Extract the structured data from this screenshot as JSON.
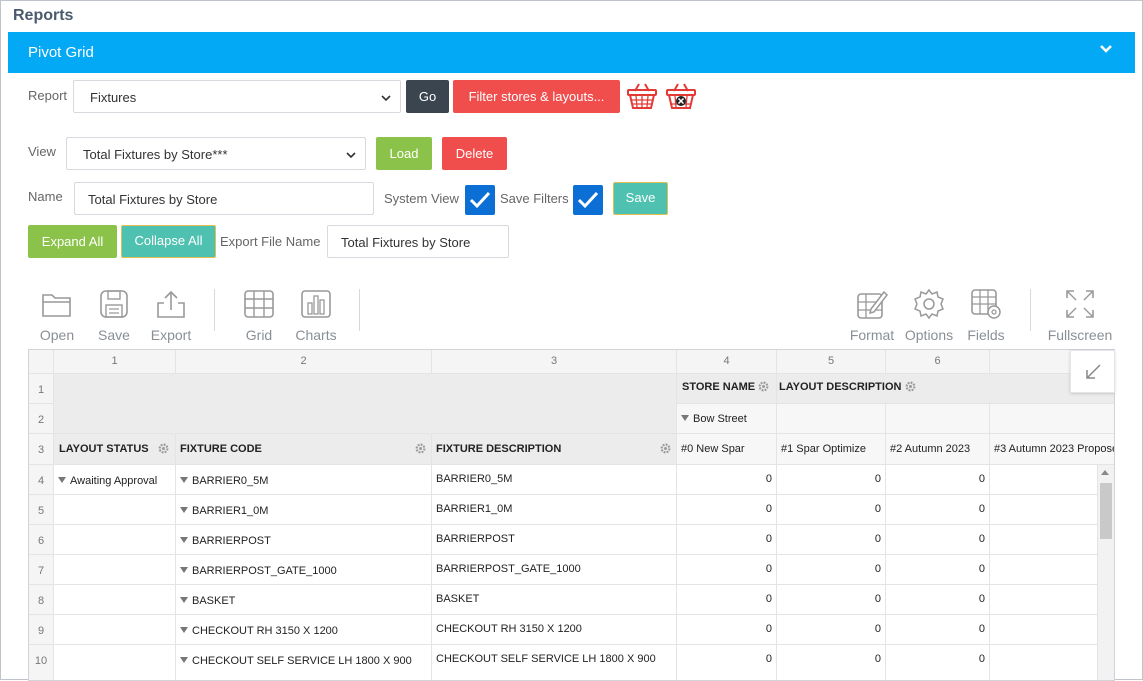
{
  "page": {
    "title": "Reports"
  },
  "panel": {
    "title": "Pivot Grid"
  },
  "report": {
    "label": "Report",
    "selected": "Fixtures",
    "go": "Go",
    "filter": "Filter stores & layouts..."
  },
  "view": {
    "label": "View",
    "selected": "Total Fixtures by Store***",
    "load": "Load",
    "delete": "Delete"
  },
  "name": {
    "label": "Name",
    "value": "Total Fixtures by Store",
    "system_view": "System View",
    "save_filters": "Save Filters",
    "save": "Save"
  },
  "expand": {
    "expand_all": "Expand All",
    "collapse_all": "Collapse All",
    "export_label": "Export File Name",
    "export_value": "Total Fixtures by Store"
  },
  "toolbar": {
    "open": "Open",
    "save": "Save",
    "export": "Export",
    "grid": "Grid",
    "charts": "Charts",
    "format": "Format",
    "options": "Options",
    "fields": "Fields",
    "fullscreen": "Fullscreen"
  },
  "colors": {
    "header": "#03a9f4",
    "dark": "#3b4550",
    "red": "#f04d4d",
    "green": "#8bc34a",
    "teal": "#4fc1b1",
    "check": "#0b6fd6"
  },
  "grid": {
    "col_numbers": [
      "1",
      "2",
      "3",
      "4",
      "5",
      "6"
    ],
    "row_numbers": [
      "1",
      "2",
      "3",
      "4",
      "5",
      "6",
      "7",
      "8",
      "9",
      "10"
    ],
    "store_name": "STORE NAME",
    "layout_description": "LAYOUT DESCRIPTION",
    "store": "Bow Street",
    "layout_status": "LAYOUT STATUS",
    "fixture_code": "FIXTURE CODE",
    "fixture_description": "FIXTURE DESCRIPTION",
    "layouts": [
      "#0 New Spar",
      "#1 Spar Optimize",
      "#2 Autumn 2023",
      "#3 Autumn 2023 Propose"
    ],
    "status_value": "Awaiting Approval",
    "rows": [
      {
        "code": "BARRIER0_5M",
        "desc": "BARRIER0_5M",
        "v0": "0",
        "v1": "0",
        "v2": "0"
      },
      {
        "code": "BARRIER1_0M",
        "desc": "BARRIER1_0M",
        "v0": "0",
        "v1": "0",
        "v2": "0"
      },
      {
        "code": "BARRIERPOST",
        "desc": "BARRIERPOST",
        "v0": "0",
        "v1": "0",
        "v2": "0"
      },
      {
        "code": "BARRIERPOST_GATE_1000",
        "desc": "BARRIERPOST_GATE_1000",
        "v0": "0",
        "v1": "0",
        "v2": "0"
      },
      {
        "code": "BASKET",
        "desc": "BASKET",
        "v0": "0",
        "v1": "0",
        "v2": "0"
      },
      {
        "code": "CHECKOUT RH 3150 X 1200",
        "desc": "CHECKOUT RH 3150 X 1200",
        "v0": "0",
        "v1": "0",
        "v2": "0"
      },
      {
        "code": "CHECKOUT SELF SERVICE LH 1800 X 900",
        "desc": "CHECKOUT SELF SERVICE LH 1800 X 900",
        "v0": "0",
        "v1": "0",
        "v2": "0"
      }
    ]
  }
}
